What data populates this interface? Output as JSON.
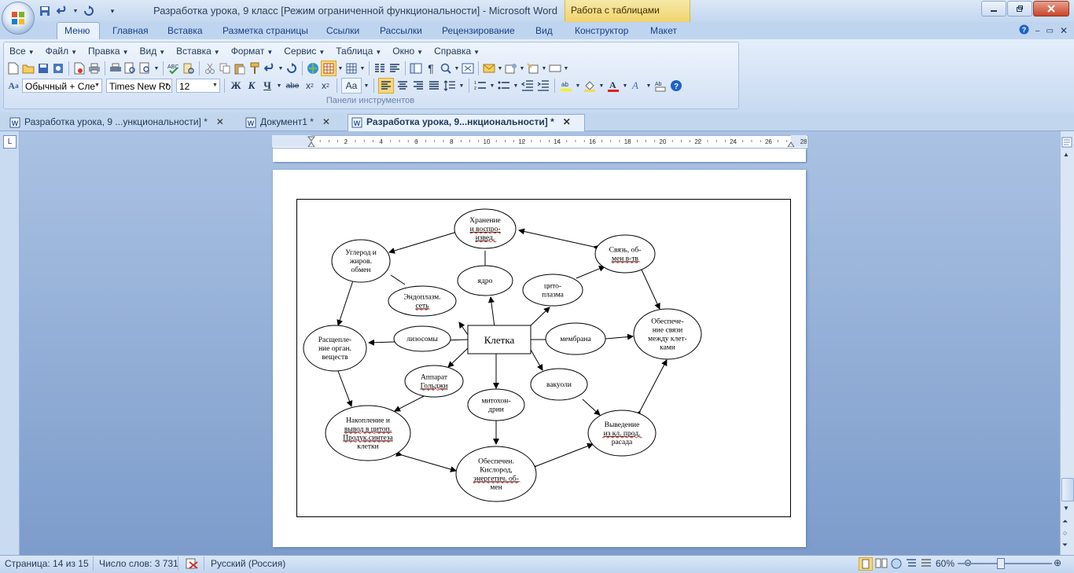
{
  "window": {
    "title": "Разработка урока, 9 класс [Режим ограниченной функциональности] - Microsoft Word",
    "context_tab": "Работа с таблицами"
  },
  "ribbon_tabs": [
    "Меню",
    "Главная",
    "Вставка",
    "Разметка страницы",
    "Ссылки",
    "Рассылки",
    "Рецензирование",
    "Вид",
    "Конструктор",
    "Макет"
  ],
  "menubar": [
    "Все",
    "Файл",
    "Правка",
    "Вид",
    "Вставка",
    "Формат",
    "Сервис",
    "Таблица",
    "Окно",
    "Справка"
  ],
  "toolbar": {
    "style_value": "Обычный + Сле",
    "font_value": "Times New Ro",
    "size_value": "12",
    "group_label": "Панели инструментов"
  },
  "doc_tabs": [
    {
      "label": "Разработка урока, 9 ...ункциональности]  *"
    },
    {
      "label": "Документ1  *"
    },
    {
      "label": "Разработка урока, 9...нкциональности]  *"
    }
  ],
  "ruler": {
    "numbers": [
      "2",
      "4",
      "6",
      "8",
      "10",
      "12",
      "14",
      "16",
      "18",
      "20",
      "22",
      "24",
      "26",
      "28"
    ]
  },
  "diagram": {
    "center": "Клетка",
    "nodes": {
      "storage": [
        "Хранение",
        "и воспро-",
        "извед."
      ],
      "nucleus": [
        "ядро"
      ],
      "carbon": [
        "Углерод и",
        "жиров.",
        "обмен"
      ],
      "er": [
        "Эндоплазм.",
        "сеть"
      ],
      "cytoplasm": [
        "цито-",
        "плазма"
      ],
      "communication": [
        "Связь, об-",
        "мен в-тв"
      ],
      "lysosomes": [
        "лизосомы"
      ],
      "membrane": [
        "мембрана"
      ],
      "breakdown": [
        "Расщепле-",
        "ние орган.",
        "веществ"
      ],
      "cellconn": [
        "Обеспече-",
        "ние связи",
        "между клет-",
        "ками"
      ],
      "golgi": [
        "Аппарат",
        "Гольджи"
      ],
      "vacuoles": [
        "вакуоли"
      ],
      "mito": [
        "митохон-",
        "дрии"
      ],
      "accum": [
        "Накопление и",
        "вывод в цитоп.",
        "Продук.синтеза",
        "клетки"
      ],
      "excretion": [
        "Выведение",
        "из кл. прод.",
        "расада"
      ],
      "oxygen": [
        "Обеспечен.",
        "Кислород,",
        "энергетич. об-",
        "мен"
      ]
    }
  },
  "status": {
    "page": "Страница: 14 из 15",
    "words": "Число слов: 3 731",
    "language": "Русский (Россия)",
    "zoom": "60%",
    "zoom_level": 60
  }
}
